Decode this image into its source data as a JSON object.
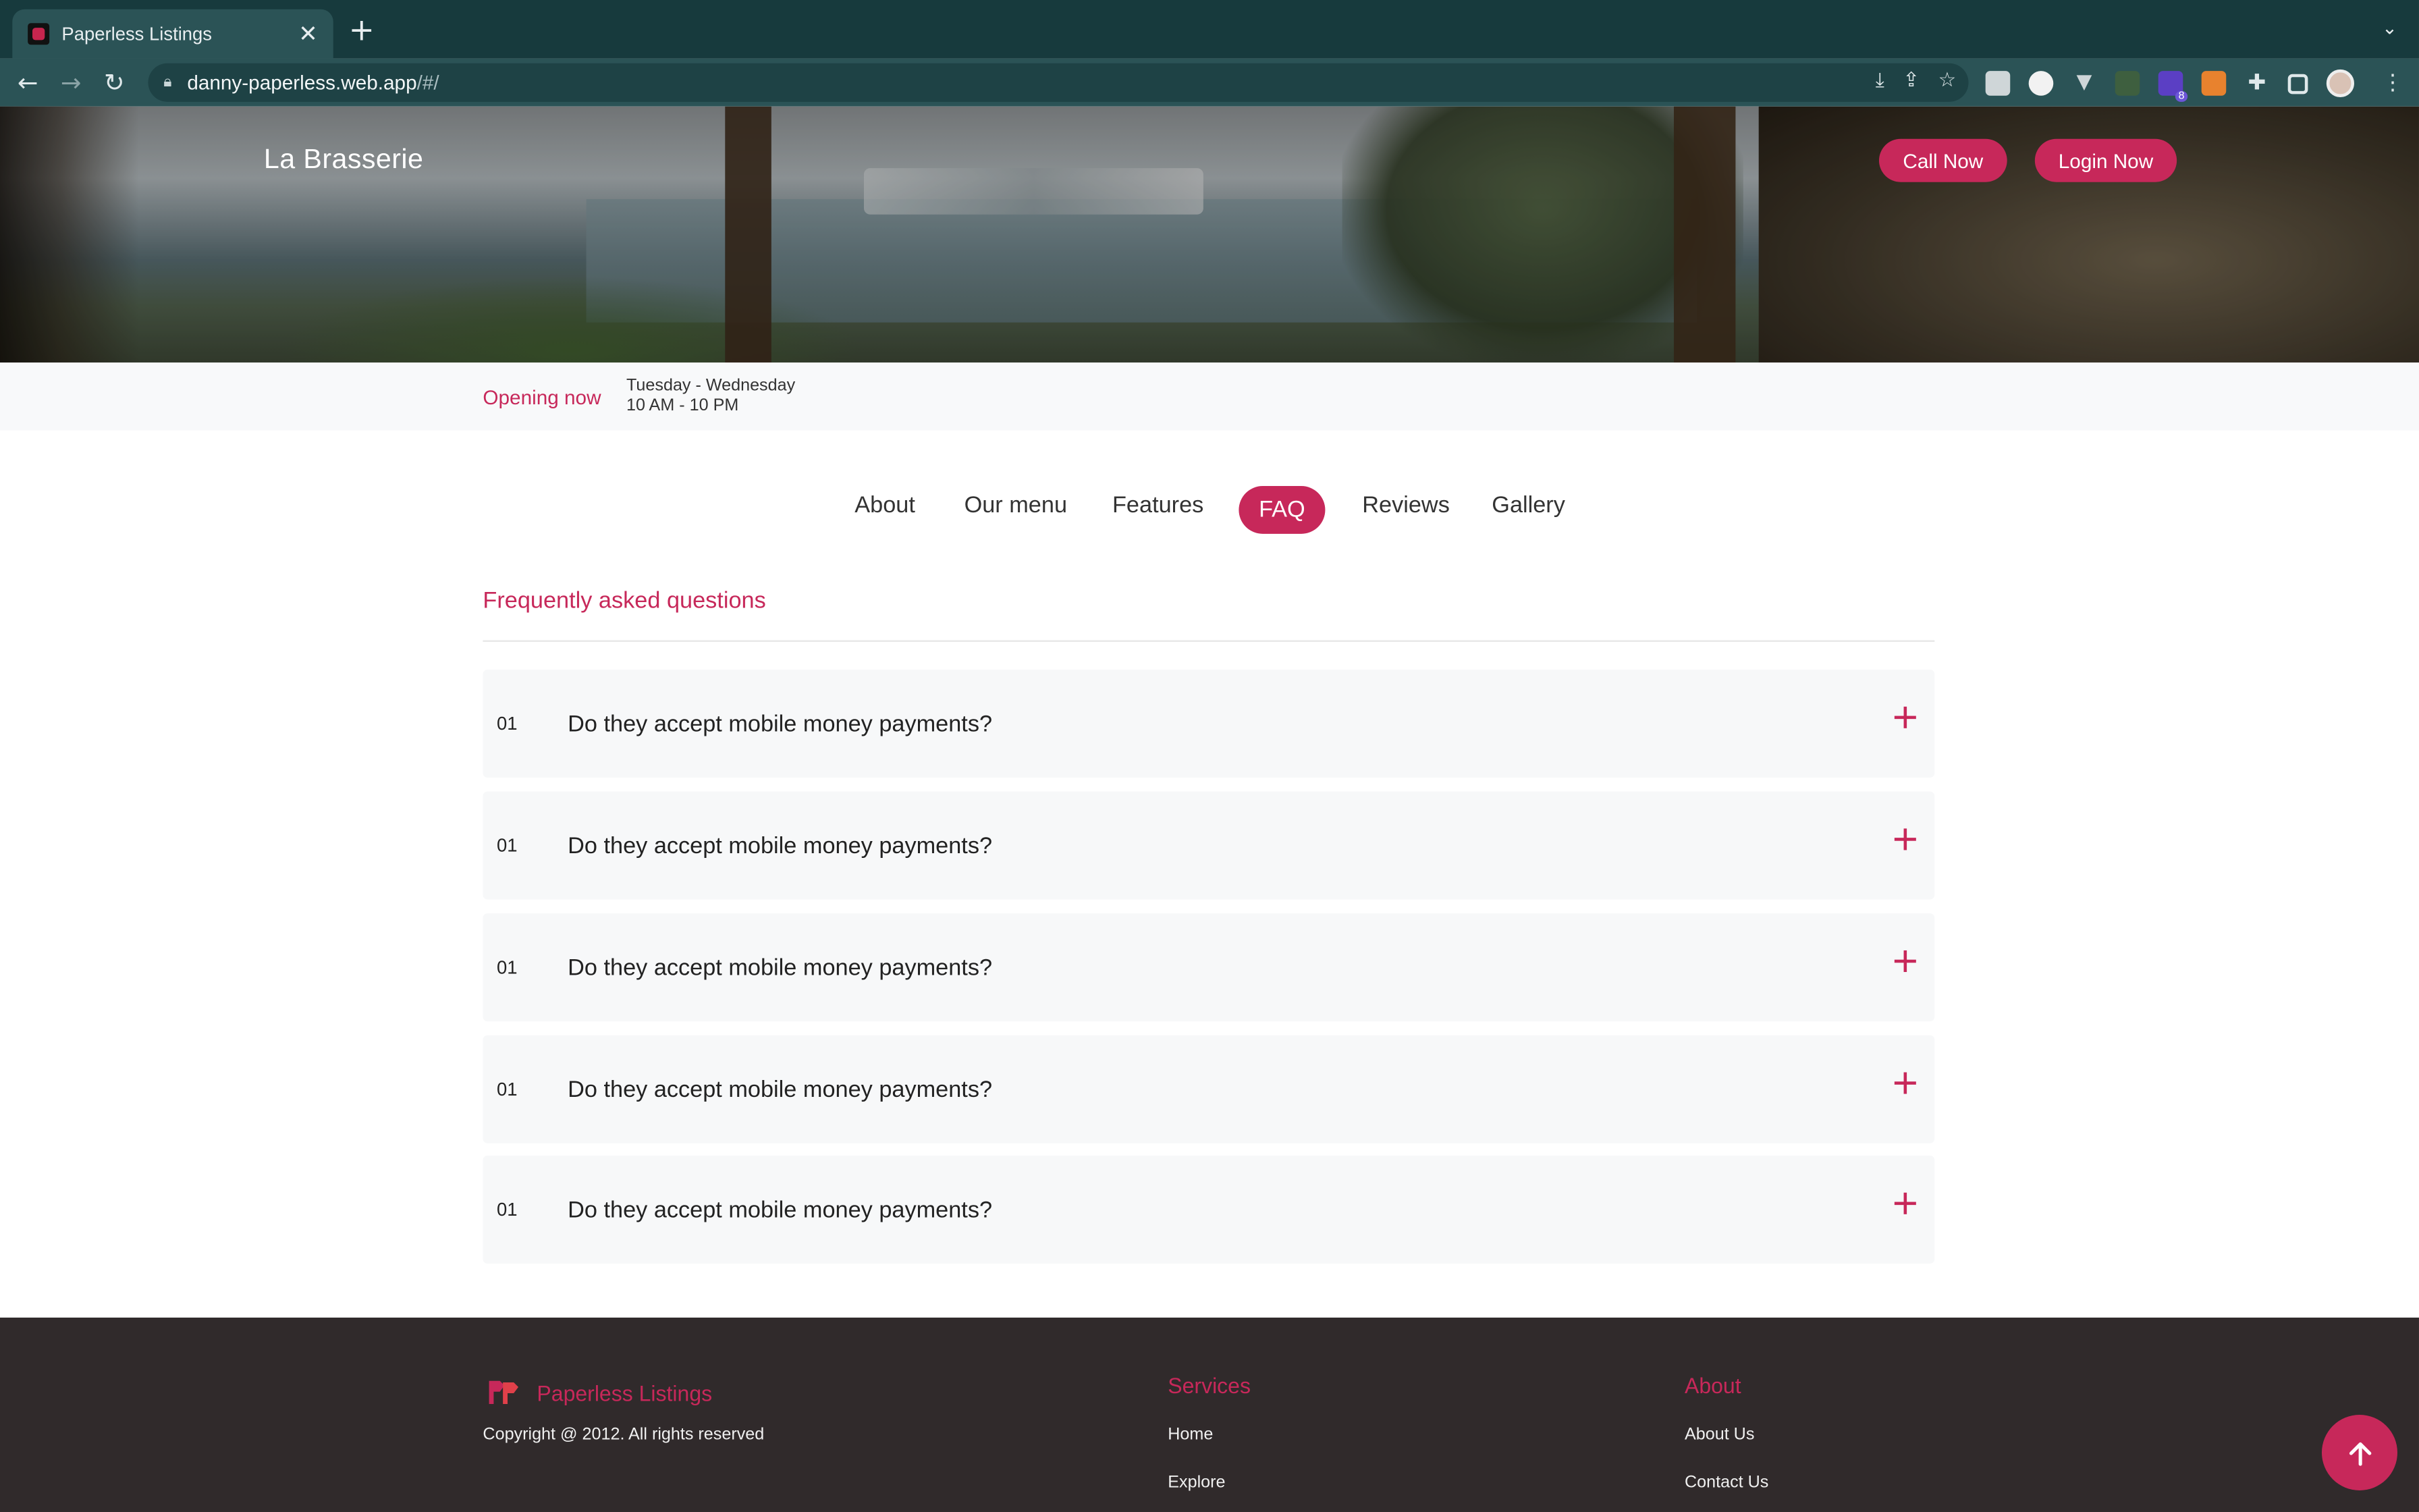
{
  "browser": {
    "tab_title": "Paperless Listings",
    "tab_close": "✕",
    "new_tab": "+",
    "url_host": "danny-paperless.web.app",
    "url_path": "/#/",
    "back": "←",
    "forward": "→",
    "reload": "↻",
    "menu": "⋮",
    "extension_badge": "8"
  },
  "hero": {
    "brand": "La Brasserie",
    "call_button": "Call Now",
    "login_button": "Login Now"
  },
  "hours": {
    "status": "Opening now",
    "days": "Tuesday - Wednesday",
    "time": "10 AM - 10 PM"
  },
  "section_nav": {
    "items": [
      "About",
      "Our menu",
      "Features",
      "FAQ",
      "Reviews",
      "Gallery"
    ],
    "active": "FAQ"
  },
  "faq": {
    "title": "Frequently asked questions",
    "items": [
      {
        "number": "01",
        "question": "Do they accept mobile money payments?"
      },
      {
        "number": "01",
        "question": "Do they accept mobile money payments?"
      },
      {
        "number": "01",
        "question": "Do they accept mobile money payments?"
      },
      {
        "number": "01",
        "question": "Do they accept mobile money payments?"
      },
      {
        "number": "01",
        "question": "Do they accept mobile money payments?"
      }
    ]
  },
  "footer": {
    "brand": "Paperless Listings",
    "copyright": "Copyright @ 2012. All rights reserved",
    "services": {
      "heading": "Services",
      "links": [
        "Home",
        "Explore"
      ]
    },
    "about": {
      "heading": "About",
      "links": [
        "About Us",
        "Contact Us"
      ]
    }
  },
  "colors": {
    "accent": "#c7285a",
    "chrome_dark": "#173a3d",
    "chrome_toolbar": "#2b5356",
    "footer_bg": "#302a2b",
    "light_bg": "#f8f9fa"
  }
}
